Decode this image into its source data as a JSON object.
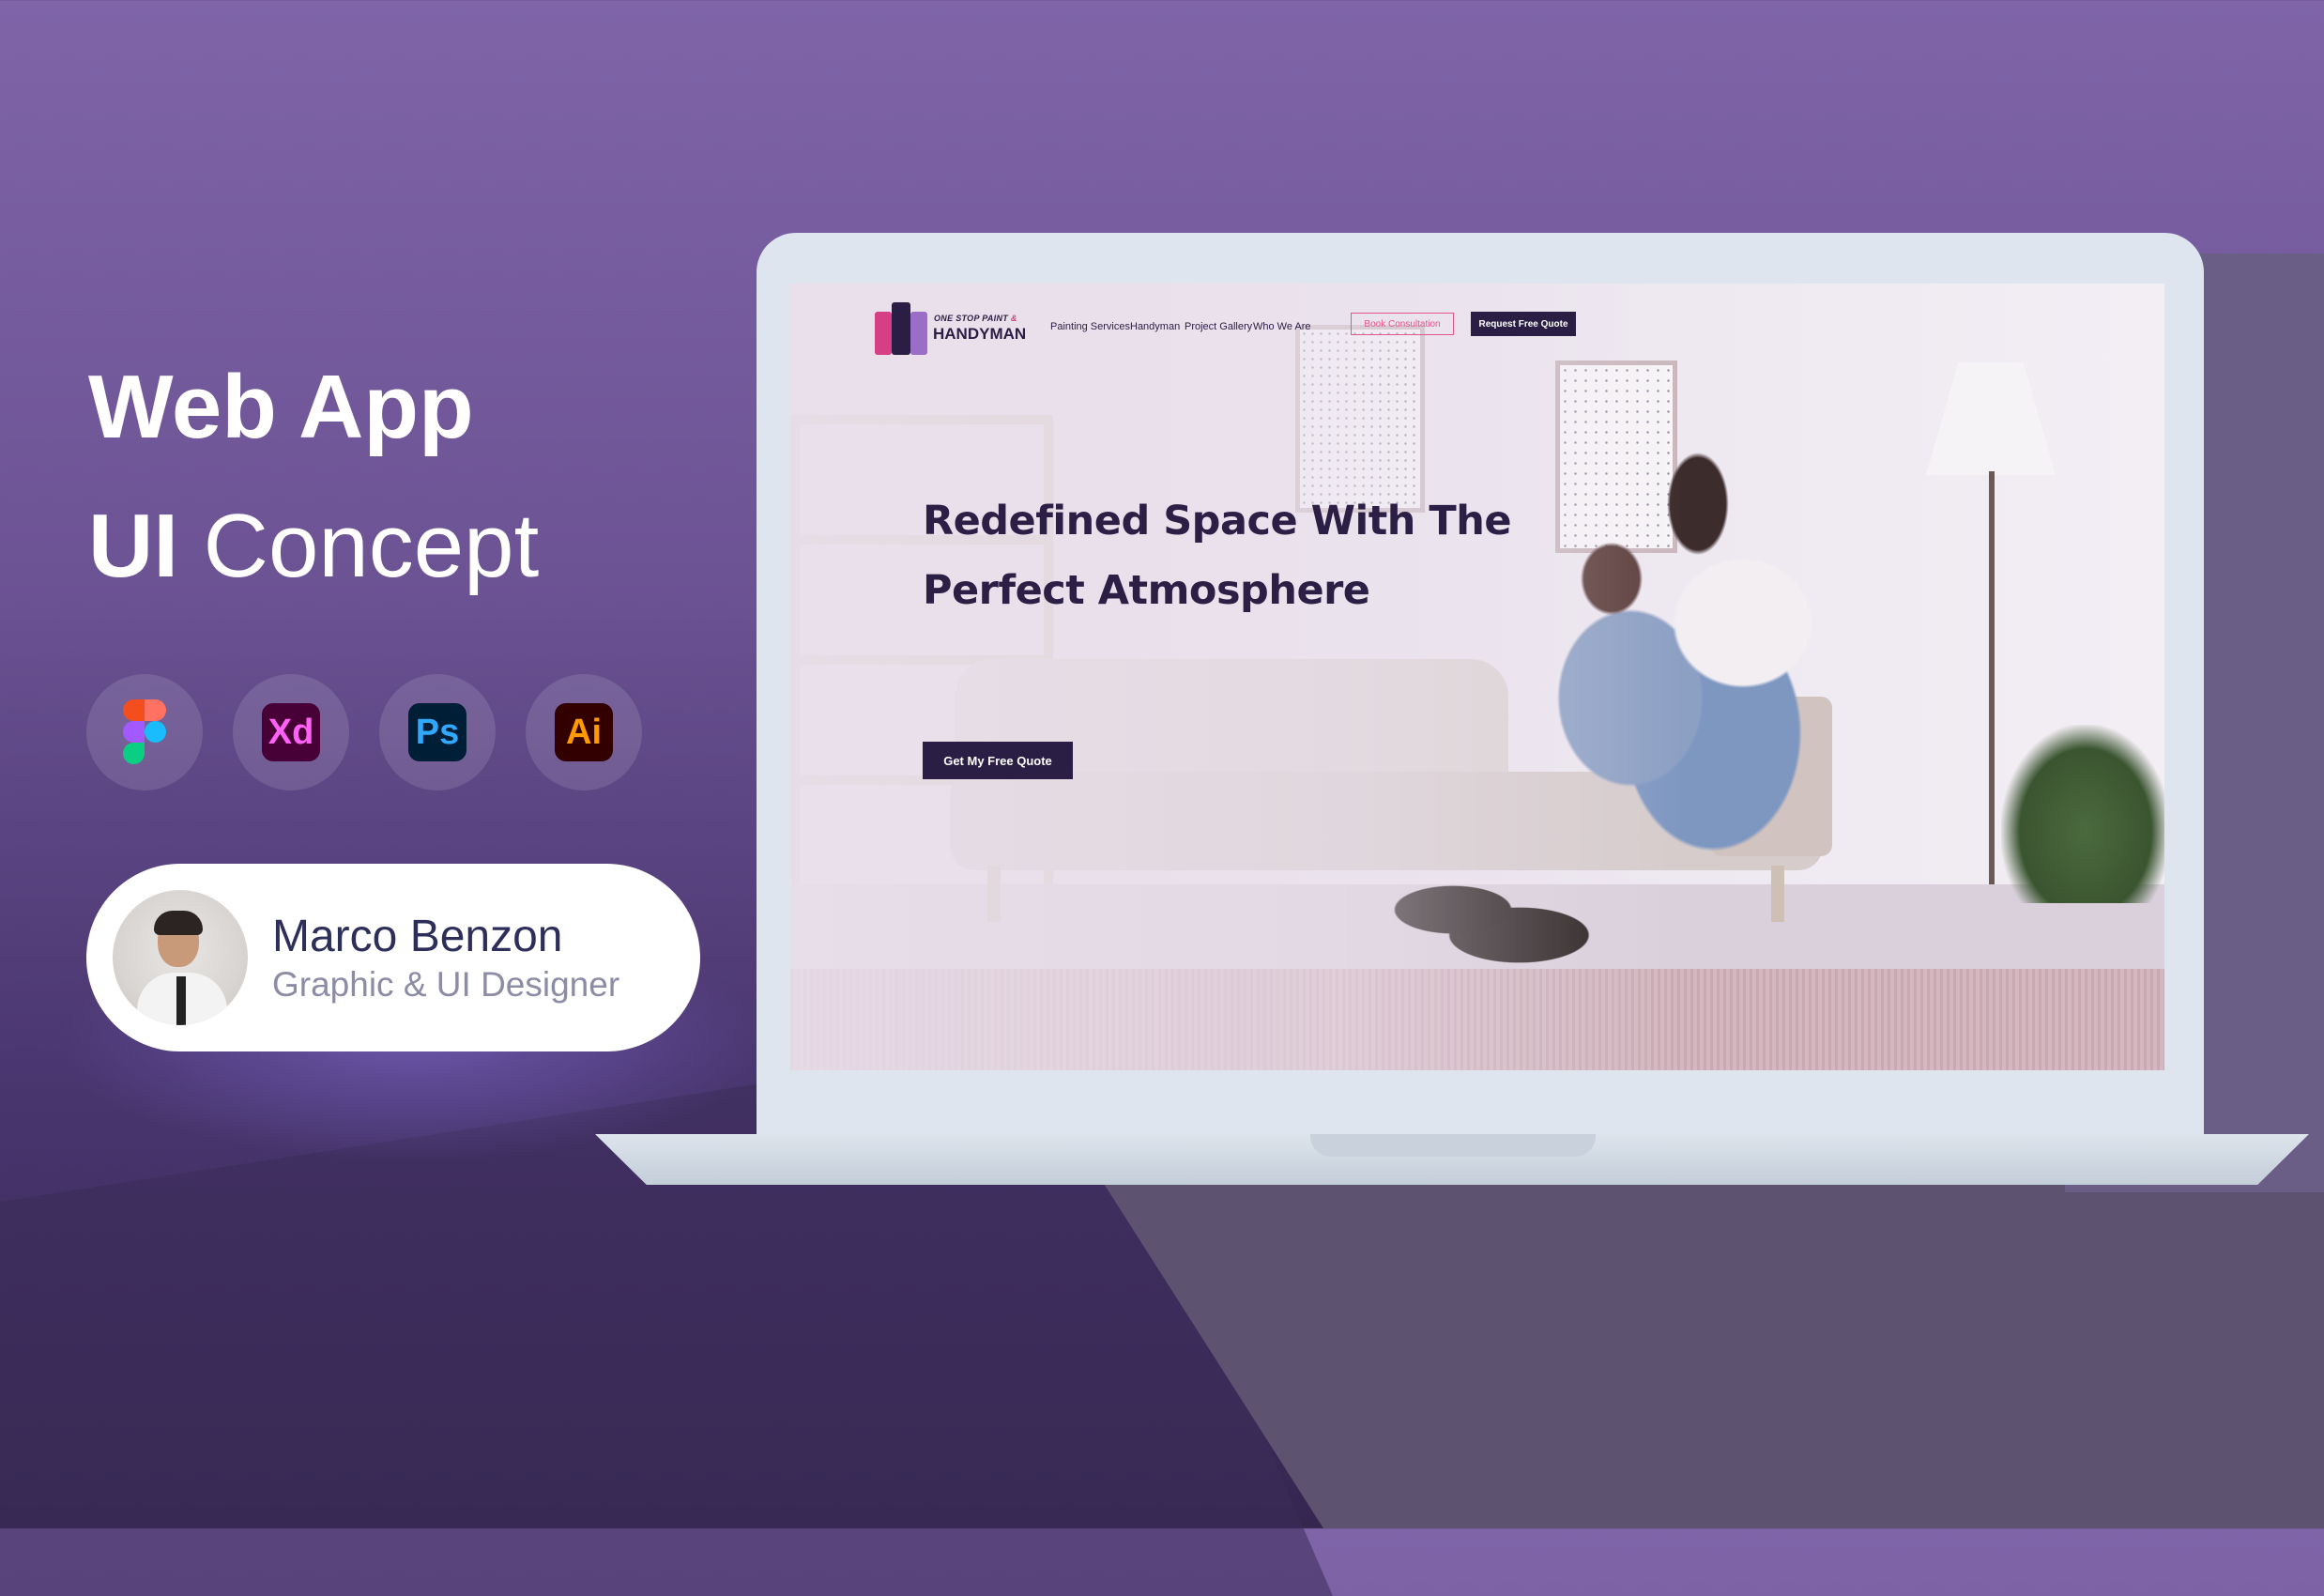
{
  "promo": {
    "title_line1": "Web App",
    "title_line2_bold": "UI",
    "title_line2_regular": "Concept",
    "tools": [
      {
        "name": "figma",
        "label": ""
      },
      {
        "name": "adobe-xd",
        "label": "Xd"
      },
      {
        "name": "photoshop",
        "label": "Ps"
      },
      {
        "name": "illustrator",
        "label": "Ai"
      }
    ]
  },
  "author": {
    "name": "Marco Benzon",
    "role": "Graphic & UI Designer"
  },
  "site": {
    "brand_tagline": "ONE STOP PAINT",
    "brand_amp": "&",
    "brand_name": "HANDYMAN",
    "nav": [
      "Painting Services",
      "Handyman",
      "Project Gallery",
      "Who We Are"
    ],
    "book_button": "Book Consultation",
    "quote_button": "Request Free Quote",
    "headline_line1": "Redefined Space With The",
    "headline_line2": "Perfect Atmosphere",
    "cta_button": "Get My Free Quote"
  },
  "colors": {
    "brand_dark": "#2a1e44",
    "brand_pink": "#d73f84",
    "brand_purple": "#9a6ec7",
    "background": "#6c5394"
  }
}
